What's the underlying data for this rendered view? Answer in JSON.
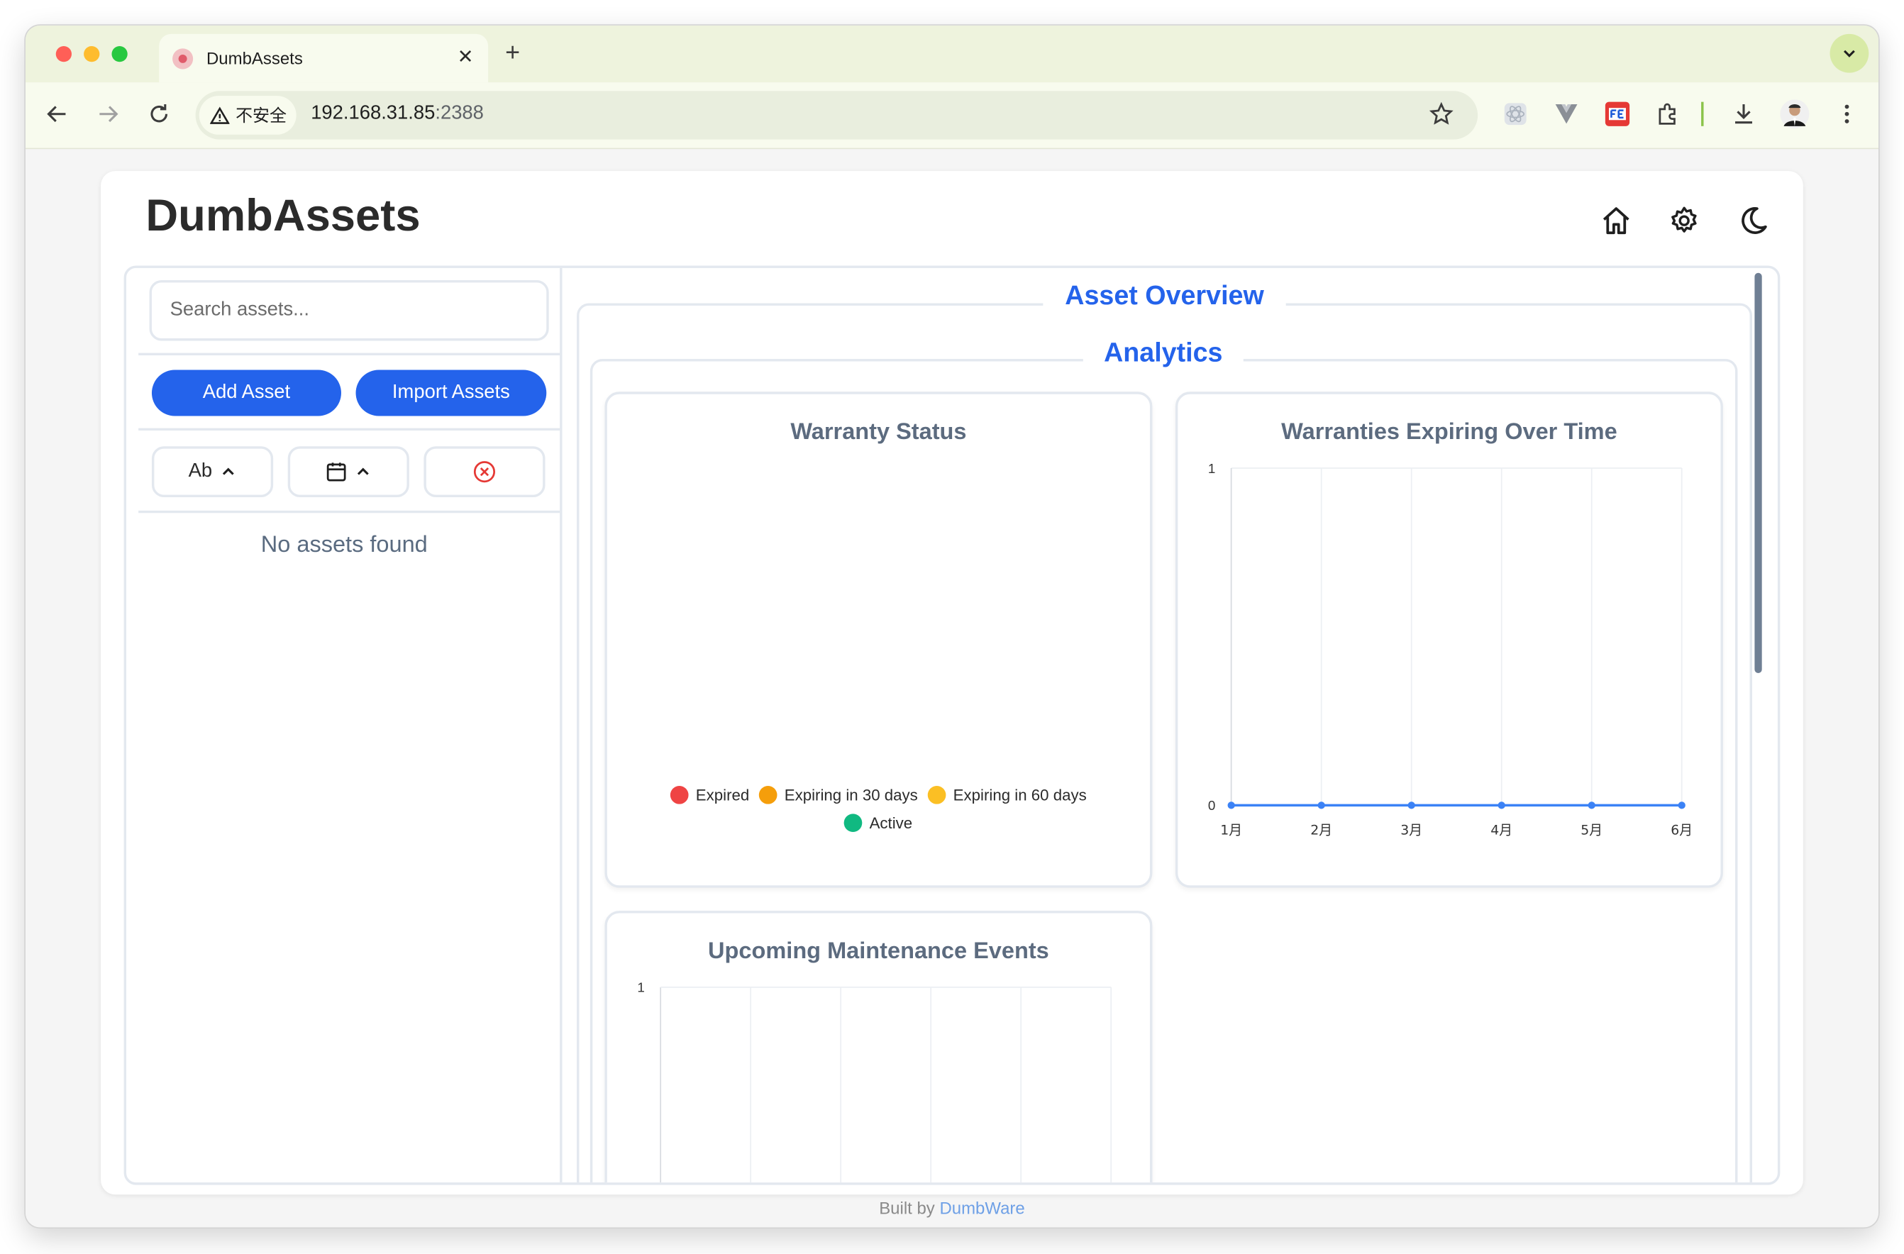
{
  "browser": {
    "tab_title": "DumbAssets",
    "close_glyph": "✕",
    "new_tab_glyph": "+",
    "security_label": "不安全",
    "url_host": "192.168.31.85",
    "url_port": ":2388",
    "extensions": [
      "react-devtools-icon",
      "vue-devtools-icon",
      "fe-helper-icon",
      "extensions-puzzle-icon"
    ],
    "colors": {
      "tab_strip": "#eef3dd",
      "toolbar": "#f8fbee",
      "accent": "#d8eaa6"
    }
  },
  "app": {
    "title": "DumbAssets",
    "header_icons": [
      "home-icon",
      "settings-gear-icon",
      "dark-mode-moon-icon"
    ],
    "accent_color": "#2463eb"
  },
  "sidebar": {
    "search_placeholder": "Search assets...",
    "add_button": "Add Asset",
    "import_button": "Import Assets",
    "sort_name_label": "Ab",
    "sort_icons": [
      "chevron-up-icon",
      "calendar-icon",
      "chevron-up-icon",
      "clear-circle-x-icon"
    ],
    "empty_text": "No assets found"
  },
  "main": {
    "overview_title": "Asset Overview",
    "analytics_title": "Analytics"
  },
  "chart_data": [
    {
      "type": "pie",
      "title": "Warranty Status",
      "categories": [
        "Expired",
        "Expiring in 30 days",
        "Expiring in 60 days",
        "Active"
      ],
      "values": [
        0,
        0,
        0,
        0
      ],
      "colors": [
        "#ef4444",
        "#f59e0b",
        "#fbbf24",
        "#10b981"
      ],
      "legend": "bottom"
    },
    {
      "type": "line",
      "title": "Warranties Expiring Over Time",
      "x": [
        "1月",
        "2月",
        "3月",
        "4月",
        "5月",
        "6月"
      ],
      "series": [
        {
          "values": [
            0,
            0,
            0,
            0,
            0,
            0
          ],
          "color": "#3b82f6"
        }
      ],
      "ylim": [
        0,
        1
      ],
      "yticks": [
        "0",
        "1"
      ],
      "grid": true
    },
    {
      "type": "line",
      "title": "Upcoming Maintenance Events",
      "x": [],
      "series": [],
      "ylim": [
        0,
        1
      ],
      "yticks": [
        "1"
      ],
      "grid": true
    }
  ],
  "footer": {
    "prefix": "Built by",
    "link": "DumbWare"
  }
}
